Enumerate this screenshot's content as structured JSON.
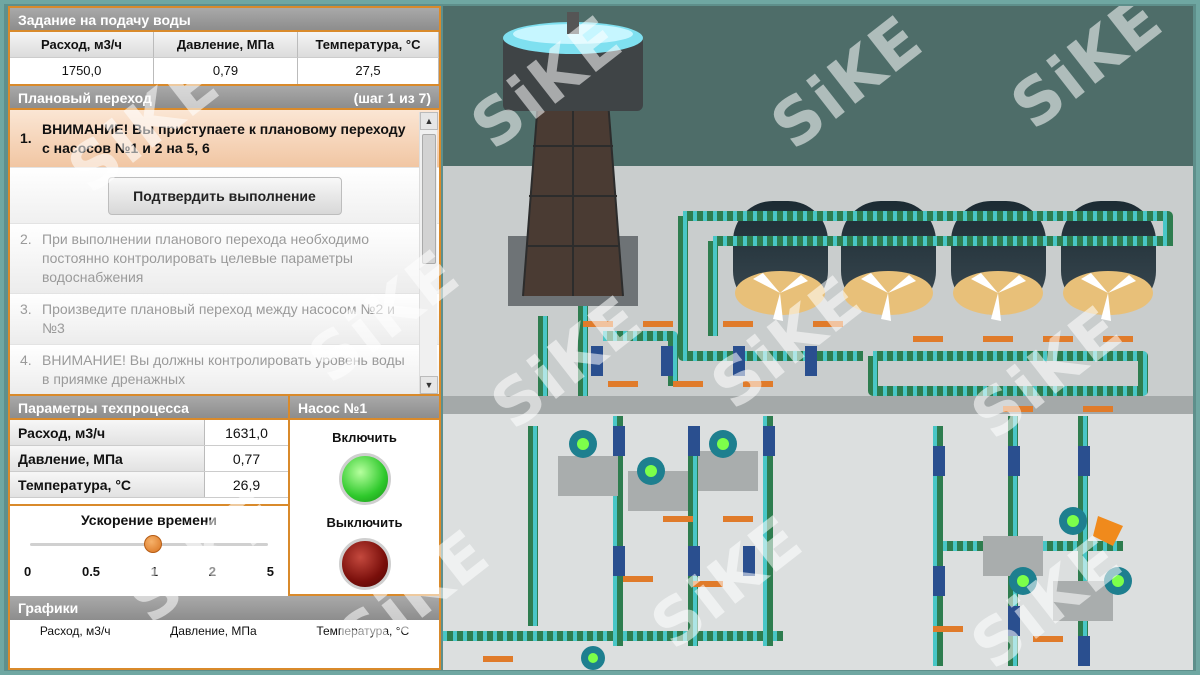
{
  "target": {
    "title": "Задание на подачу воды",
    "columns": [
      "Расход, м3/ч",
      "Давление, МПа",
      "Температура, °С"
    ],
    "values": [
      "1750,0",
      "0,79",
      "27,5"
    ]
  },
  "plan": {
    "title": "Плановый переход",
    "step_counter": "(шаг 1 из 7)",
    "confirm_label": "Подтвердить выполнение",
    "steps": [
      {
        "num": "1.",
        "text": "ВНИМАНИЕ! Вы приступаете к плановому переходу с насосов №1 и 2 на 5, 6"
      },
      {
        "num": "2.",
        "text": "При выполнении планового перехода необходимо постоянно контролировать целевые параметры водоснабжения"
      },
      {
        "num": "3.",
        "text": "Произведите плановый переход между насосом №2 и №3"
      },
      {
        "num": "4.",
        "text": "ВНИМАНИЕ! Вы должны контролировать уровень воды в приямке дренажных"
      }
    ]
  },
  "process": {
    "title": "Параметры техпроцесса",
    "rows": [
      {
        "label": "Расход, м3/ч",
        "value": "1631,0"
      },
      {
        "label": "Давление, МПа",
        "value": "0,77"
      },
      {
        "label": "Температура, °С",
        "value": "26,9"
      }
    ]
  },
  "speed": {
    "title": "Ускорение времени",
    "ticks": [
      "0",
      "0.5",
      "1",
      "2",
      "5"
    ],
    "selected": "1"
  },
  "pump": {
    "title": "Насос №1",
    "on_label": "Включить",
    "off_label": "Выключить"
  },
  "charts": {
    "title": "Графики",
    "legend": [
      "Расход, м3/ч",
      "Давление, МПа",
      "Температура, °С"
    ]
  },
  "watermark": "SiKE",
  "colors": {
    "accent": "#d98a2b",
    "header": "#9a9a9a",
    "pipe": "#2e7d4f",
    "pipe_stripe": "#49c6c6",
    "lamp_on": "#2fc92c",
    "lamp_off": "#7a0f0b"
  }
}
